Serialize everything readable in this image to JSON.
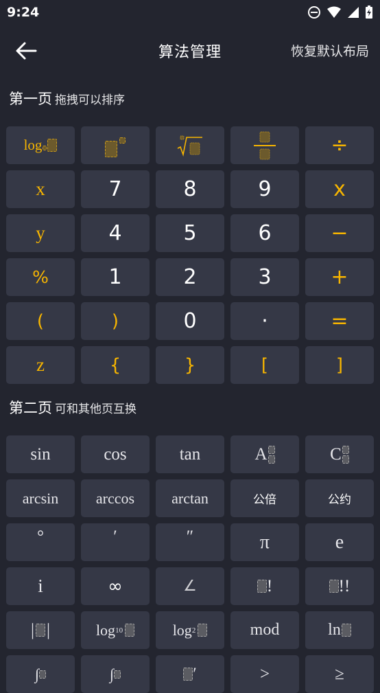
{
  "status_bar": {
    "time": "9:24"
  },
  "app_bar": {
    "title": "算法管理",
    "reset_label": "恢复默认布局"
  },
  "page1": {
    "title": "第一页",
    "hint": "拖拽可以排序",
    "keys": {
      "log_prefix": "log",
      "k7": "7",
      "k8": "8",
      "k9": "9",
      "k4": "4",
      "k5": "5",
      "k6": "6",
      "k1": "1",
      "k2": "2",
      "k3": "3",
      "k0": "0",
      "dot": "·",
      "x_var": "x",
      "y_var": "y",
      "z_var": "z",
      "times": "x",
      "divide": "÷",
      "minus": "−",
      "plus": "+",
      "equals": "=",
      "percent": "%",
      "lparen": "(",
      "rparen": ")",
      "lbrace": "{",
      "rbrace": "}",
      "lbracket": "[",
      "rbracket": "]"
    }
  },
  "page2": {
    "title": "第二页",
    "hint": "可和其他页互换",
    "keys": {
      "sin": "sin",
      "cos": "cos",
      "tan": "tan",
      "a": "A",
      "c": "C",
      "arcsin": "arcsin",
      "arccos": "arccos",
      "arctan": "arctan",
      "lcm": "公倍",
      "gcd": "公约",
      "degree": "°",
      "minute": "′",
      "second": "″",
      "pi": "π",
      "e": "e",
      "i": "i",
      "infinity": "∞",
      "angle": "∠",
      "factorial": "!",
      "double_factorial": "!!",
      "abs_bar": "|",
      "log10": "log",
      "log10_sub": "10",
      "log2": "log",
      "log2_sub": "2",
      "mod": "mod",
      "ln": "ln",
      "gt": ">",
      "gte": "≥"
    }
  },
  "colors": {
    "background": "#23252f",
    "key": "#353846",
    "accent": "#f7b500"
  }
}
